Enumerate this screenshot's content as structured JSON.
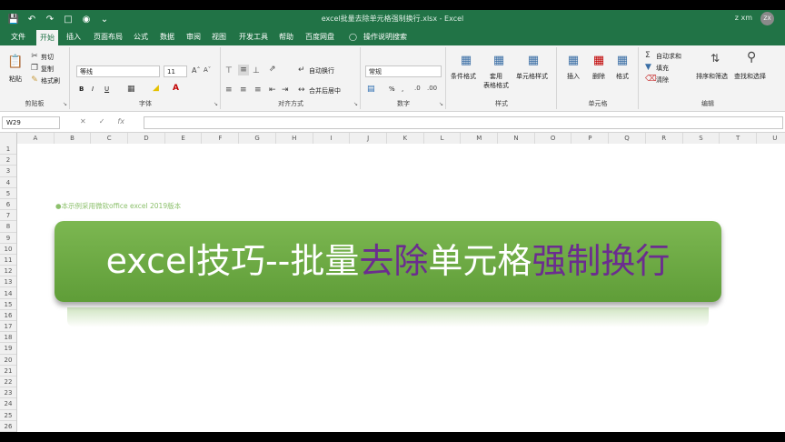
{
  "window": {
    "title": "excel批量去除单元格强制换行.xlsx  -  Excel",
    "user": "z xm",
    "avatar": "ZX"
  },
  "tabs": [
    "文件",
    "开始",
    "插入",
    "页面布局",
    "公式",
    "数据",
    "审阅",
    "视图",
    "开发工具",
    "帮助",
    "百度网盘",
    "操作说明搜索"
  ],
  "ribbon": {
    "clipboard": {
      "paste": "粘贴",
      "cut": "剪切",
      "copy": "复制",
      "painter": "格式刷",
      "label": "剪贴板"
    },
    "font": {
      "name": "等线",
      "size": "11",
      "bold": "B",
      "italic": "I",
      "underline": "U",
      "label": "字体"
    },
    "align": {
      "wrap": "自动换行",
      "merge": "合并后居中",
      "label": "对齐方式"
    },
    "number": {
      "format": "常规",
      "percent": "%",
      "comma": ",",
      "label": "数字"
    },
    "styles": {
      "conditional": "条件格式",
      "table": "套用\n表格格式",
      "cell": "单元格样式",
      "label": "样式"
    },
    "cells": {
      "insert": "插入",
      "delete": "删除",
      "format": "格式",
      "label": "单元格"
    },
    "editing": {
      "autosum": "自动求和",
      "fill": "填充",
      "clear": "清除",
      "sort": "排序和筛选",
      "find": "查找和选择",
      "label": "编辑"
    }
  },
  "formula_bar": {
    "name_box": "W29",
    "fx": "fx",
    "value": ""
  },
  "columns": [
    "A",
    "B",
    "C",
    "D",
    "E",
    "F",
    "G",
    "H",
    "I",
    "J",
    "K",
    "L",
    "M",
    "N",
    "O",
    "P",
    "Q",
    "R",
    "S",
    "T",
    "U"
  ],
  "rows": [
    "1",
    "2",
    "3",
    "4",
    "5",
    "6",
    "7",
    "8",
    "9",
    "10",
    "11",
    "12",
    "13",
    "14",
    "15",
    "16",
    "17",
    "18",
    "19",
    "20",
    "21",
    "22",
    "23",
    "24",
    "25",
    "26"
  ],
  "sheet": {
    "note": "●本示例采用微软office  excel 2019版本",
    "title_part1": "excel技巧--批量",
    "title_part2": "去除",
    "title_part3": "单元格",
    "title_part4": "强制换行"
  },
  "colors": {
    "excel_green": "#217346",
    "banner_green": "#6faa44",
    "purple": "#6b2d8f"
  }
}
